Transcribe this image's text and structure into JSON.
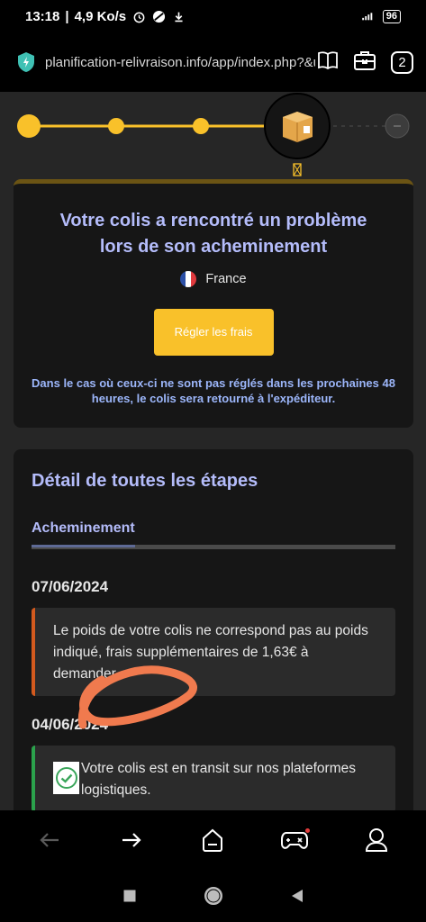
{
  "status_bar": {
    "time": "13:18",
    "speed": "4,9 Ko/s",
    "battery": "96"
  },
  "browser": {
    "url": "planification-relivraison.info/app/index.php?&u",
    "tab_count": "2"
  },
  "progress": {
    "steps_done": 3,
    "current_icon": "package-box-icon"
  },
  "alert_card": {
    "title": "Votre colis a rencontré un problème lors de son acheminement",
    "country": "France",
    "pay_button": "Régler les frais",
    "warning": "Dans le cas où ceux-ci ne sont pas réglés dans les prochaines 48 heures, le colis sera retourné à l'expéditeur."
  },
  "details_card": {
    "title": "Détail de toutes les étapes",
    "tab": "Acheminement",
    "events": [
      {
        "date": "07/06/2024",
        "text": "Le poids de votre colis ne correspond pas au poids indiqué, frais supplémentaires de 1,63€ à demander.",
        "status_color": "#d35a1e"
      },
      {
        "date": "04/06/2024",
        "text": "Votre colis est en transit sur nos plateformes logistiques.",
        "status_color": "#2ba24c"
      }
    ]
  },
  "colors": {
    "accent_yellow": "#f9c12a",
    "title_blue": "#b4bcfa",
    "annotation_orange": "#f07a4e"
  }
}
